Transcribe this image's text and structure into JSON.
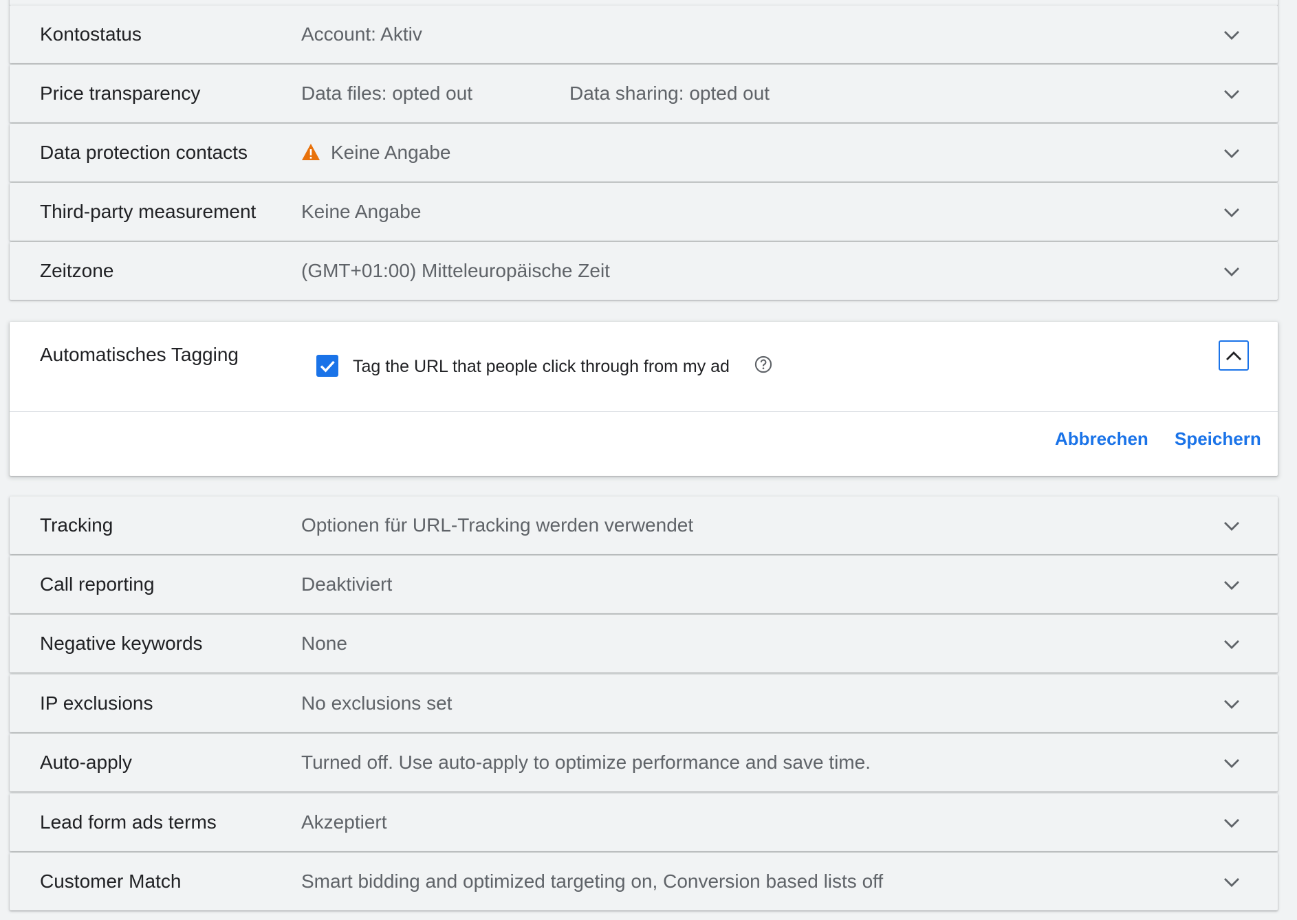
{
  "settings_top": [
    {
      "label": "Kontostatus",
      "value": "Account: Aktiv"
    },
    {
      "label": "Price transparency",
      "value": "Data files: opted out",
      "value2": "Data sharing: opted out"
    },
    {
      "label": "Data protection contacts",
      "value": "Keine Angabe",
      "icon": "warning-icon",
      "icon_color": "#e8710a"
    },
    {
      "label": "Third-party measurement",
      "value": "Keine Angabe"
    },
    {
      "label": "Zeitzone",
      "value": "(GMT+01:00) Mitteleuropäische Zeit"
    }
  ],
  "auto_tagging": {
    "label": "Automatisches Tagging",
    "checkbox_label": "Tag the URL that people click through from my ad",
    "checked": true,
    "cancel_label": "Abbrechen",
    "save_label": "Speichern"
  },
  "settings_bottom": [
    {
      "label": "Tracking",
      "value": "Optionen für URL-Tracking werden verwendet"
    },
    {
      "label": "Call reporting",
      "value": "Deaktiviert"
    },
    {
      "label": "Negative keywords",
      "value": "None"
    },
    {
      "label": "IP exclusions",
      "value": "No exclusions set"
    },
    {
      "label": "Auto-apply",
      "value": "Turned off. Use auto-apply to optimize performance and save time."
    },
    {
      "label": "Lead form ads terms",
      "value": "Akzeptiert"
    },
    {
      "label": "Customer Match",
      "value": "Smart bidding and optimized targeting on, Conversion based lists off"
    }
  ],
  "colors": {
    "accent": "#1a73e8",
    "warning": "#e8710a",
    "background": "#f1f3f4"
  }
}
